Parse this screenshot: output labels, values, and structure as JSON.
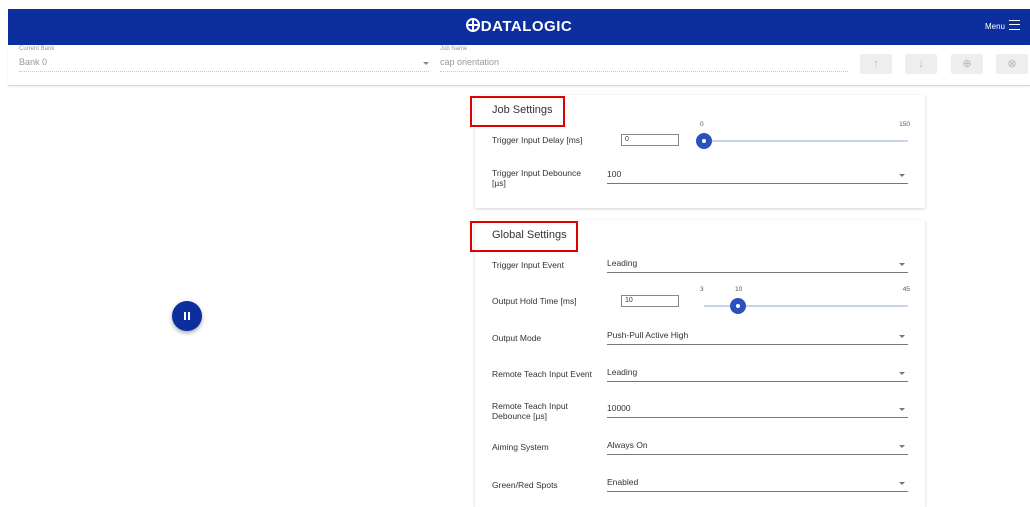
{
  "header": {
    "brand": "DATALOGIC",
    "menu_label": "Menu"
  },
  "toolbar": {
    "bank_label": "Current Bank",
    "bank_value": "Bank 0",
    "job_label": "Job Name",
    "job_value": "cap orientation",
    "buttons": [
      {
        "name": "move-up",
        "icon": "↑"
      },
      {
        "name": "move-down",
        "icon": "↓"
      },
      {
        "name": "add",
        "icon": "⊕"
      },
      {
        "name": "remove",
        "icon": "⊗"
      }
    ]
  },
  "job_settings": {
    "title": "Job Settings",
    "trigger_delay": {
      "label": "Trigger Input Delay [ms]",
      "value": "0",
      "min": "0",
      "max": "150",
      "level": 0
    },
    "trigger_debounce": {
      "label": "Trigger Input Debounce [µs]",
      "value": "100"
    }
  },
  "global_settings": {
    "title": "Global Settings",
    "trigger_event": {
      "label": "Trigger Input Event",
      "value": "Leading"
    },
    "output_hold": {
      "label": "Output Hold Time [ms]",
      "value": "10",
      "min": "3",
      "max": "45",
      "current": "10",
      "level": 0.1667
    },
    "output_mode": {
      "label": "Output Mode",
      "value": "Push-Pull Active High"
    },
    "remote_teach_event": {
      "label": "Remote Teach Input Event",
      "value": "Leading"
    },
    "remote_teach_debounce": {
      "label": "Remote Teach Input Debounce [µs]",
      "value": "10000"
    },
    "aiming": {
      "label": "Aiming System",
      "value": "Always On"
    },
    "spots": {
      "label": "Green/Red Spots",
      "value": "Enabled"
    }
  },
  "colors": {
    "primary": "#0d2f9e",
    "accent": "#2a52be",
    "highlight_box": "#e00000"
  }
}
